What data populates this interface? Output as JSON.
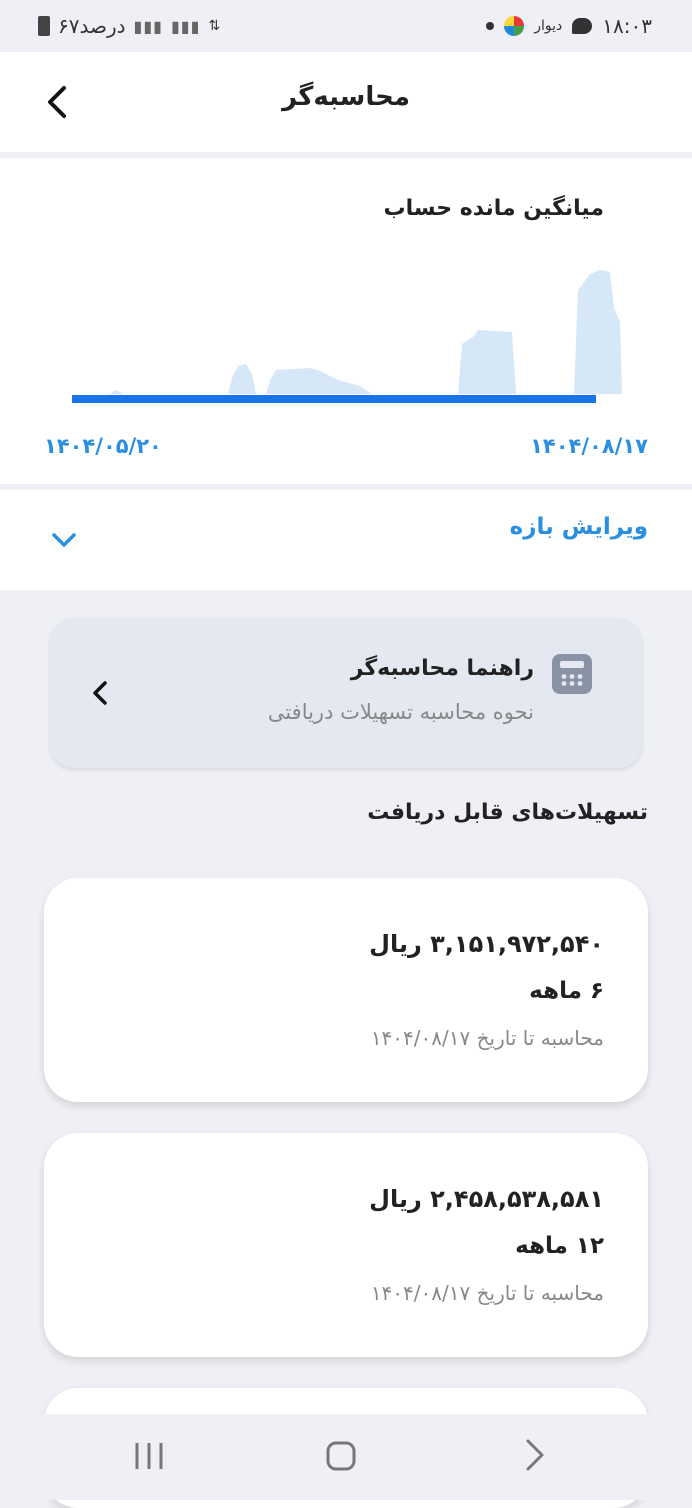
{
  "status_bar": {
    "time": "۱۸:۰۳",
    "app_label": "دیوار",
    "battery_text": "۶۷درصد"
  },
  "header": {
    "title": "محاسبه‌گر"
  },
  "chart": {
    "title": "میانگین مانده حساب",
    "start_date": "۱۴۰۴/۰۵/۲۰",
    "end_date": "۱۴۰۴/۰۸/۱۷",
    "line_color": "#1a73e8",
    "fill_color": "#d6e8f8"
  },
  "edit_range": {
    "label": "ویرایش بازه"
  },
  "guide": {
    "title": "راهنما محاسبه‌گر",
    "subtitle": "نحوه محاسبه تسهیلات دریافتی",
    "icon": "calculator-icon"
  },
  "loans_section": {
    "title": "تسهیلات‌های قابل دریافت",
    "items": [
      {
        "amount": "۳,۱۵۱,۹۷۲,۵۴۰ ریال",
        "term": "۶ ماهه",
        "date_note": "محاسبه تا تاریخ ۱۴۰۴/۰۸/۱۷"
      },
      {
        "amount": "۲,۴۵۸,۵۳۸,۵۸۱ ریال",
        "term": "۱۲ ماهه",
        "date_note": "محاسبه تا تاریخ ۱۴۰۴/۰۸/۱۷"
      }
    ]
  },
  "colors": {
    "accent": "#2a8fe0",
    "background": "#eef0f5"
  }
}
